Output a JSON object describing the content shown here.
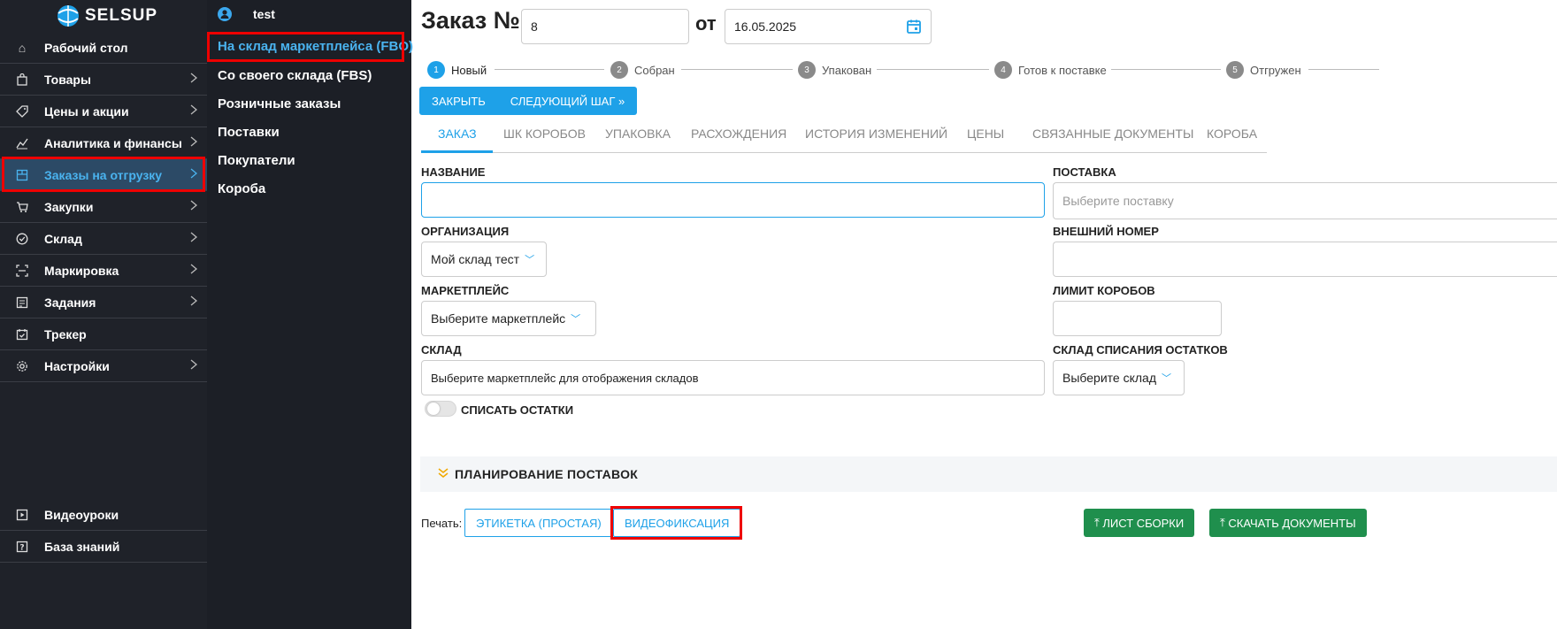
{
  "brand": {
    "logo_text": "SELSUP",
    "accent": "#1ea1e8",
    "highlight": "#e00000",
    "success": "#1f8f4d"
  },
  "sidebar": {
    "items": [
      {
        "label": "Рабочий стол",
        "icon": "home-icon",
        "chevron": false
      },
      {
        "label": "Товары",
        "icon": "bag-icon",
        "chevron": true
      },
      {
        "label": "Цены и акции",
        "icon": "tag-icon",
        "chevron": true
      },
      {
        "label": "Аналитика и финансы",
        "icon": "chart-icon",
        "chevron": true
      },
      {
        "label": "Заказы на отгрузку",
        "icon": "box-icon",
        "chevron": true,
        "active": true
      },
      {
        "label": "Закупки",
        "icon": "cart-icon",
        "chevron": true
      },
      {
        "label": "Склад",
        "icon": "check-circle-icon",
        "chevron": true
      },
      {
        "label": "Маркировка",
        "icon": "scan-icon",
        "chevron": true
      },
      {
        "label": "Задания",
        "icon": "tasks-icon",
        "chevron": true
      },
      {
        "label": "Трекер",
        "icon": "tracker-icon",
        "chevron": false
      },
      {
        "label": "Настройки",
        "icon": "gear-icon",
        "chevron": true
      }
    ],
    "bottom": [
      {
        "label": "Видеоуроки",
        "icon": "play-icon"
      },
      {
        "label": "База знаний",
        "icon": "question-icon"
      }
    ]
  },
  "submenu": {
    "user": "test",
    "items": [
      {
        "label": "На склад маркетплейса (FBO)",
        "active": true
      },
      {
        "label": "Со своего склада (FBS)"
      },
      {
        "label": "Розничные заказы"
      },
      {
        "label": "Поставки"
      },
      {
        "label": "Покупатели"
      },
      {
        "label": "Короба"
      }
    ]
  },
  "header": {
    "title": "Заказ №",
    "number": "8",
    "from_label": "от",
    "date": "16.05.2025"
  },
  "steps": [
    {
      "n": "1",
      "label": "Новый",
      "active": true
    },
    {
      "n": "2",
      "label": "Собран"
    },
    {
      "n": "3",
      "label": "Упакован"
    },
    {
      "n": "4",
      "label": "Готов к поставке"
    },
    {
      "n": "5",
      "label": "Отгружен"
    }
  ],
  "actions": {
    "close": "ЗАКРЫТЬ",
    "next": "СЛЕДУЮЩИЙ ШАГ"
  },
  "tabs": [
    {
      "label": "ЗАКАЗ",
      "active": true
    },
    {
      "label": "ШК КОРОБОВ"
    },
    {
      "label": "УПАКОВКА"
    },
    {
      "label": "РАСХОЖДЕНИЯ"
    },
    {
      "label": "ИСТОРИЯ ИЗМЕНЕНИЙ"
    },
    {
      "label": "ЦЕНЫ"
    },
    {
      "label": "СВЯЗАННЫЕ ДОКУМЕНТЫ"
    },
    {
      "label": "КОРОБА"
    }
  ],
  "form": {
    "name_label": "НАЗВАНИЕ",
    "name_value": "",
    "supply_label": "ПОСТАВКА",
    "supply_placeholder": "Выберите поставку",
    "org_label": "ОРГАНИЗАЦИЯ",
    "org_value": "Мой склад тест",
    "ext_label": "ВНЕШНИЙ НОМЕР",
    "ext_value": "",
    "mp_label": "МАРКЕТПЛЕЙС",
    "mp_value": "Выберите маркетплейс",
    "box_limit_label": "ЛИМИТ КОРОБОВ",
    "box_limit_value": "",
    "wh_label": "СКЛАД",
    "wh_value": "Выберите маркетплейс для отображения складов",
    "writeoff_wh_label": "СКЛАД СПИСАНИЯ ОСТАТКОВ",
    "writeoff_wh_value": "Выберите склад",
    "writeoff_toggle_label": "СПИСАТЬ ОСТАТКИ"
  },
  "planning": {
    "label": "ПЛАНИРОВАНИЕ ПОСТАВОК"
  },
  "print": {
    "label": "Печать:",
    "label_btn": "ЭТИКЕТКА (ПРОСТАЯ)",
    "video_btn": "ВИДЕОФИКСАЦИЯ",
    "sheet_btn": "ЛИСТ СБОРКИ",
    "docs_btn": "СКАЧАТЬ ДОКУМЕНТЫ"
  }
}
